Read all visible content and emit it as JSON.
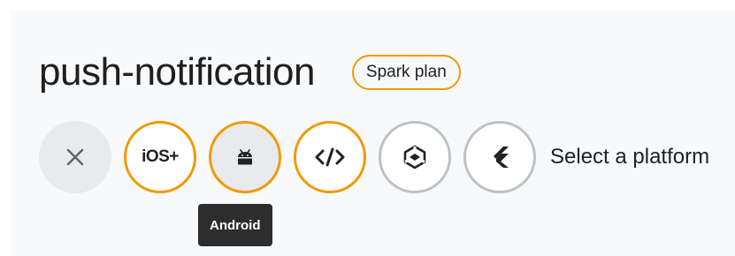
{
  "project": {
    "title": "push-notification",
    "plan_badge": "Spark plan"
  },
  "platforms": {
    "close_icon": "close-icon",
    "items": [
      {
        "id": "ios",
        "label": "iOS+",
        "icon": "ios-icon",
        "state": "selected"
      },
      {
        "id": "android",
        "icon": "android-icon",
        "state": "selected-hovered"
      },
      {
        "id": "web",
        "icon": "code-icon",
        "state": "selected"
      },
      {
        "id": "unity",
        "icon": "unity-icon",
        "state": "unselected"
      },
      {
        "id": "flutter",
        "icon": "flutter-icon",
        "state": "unselected"
      }
    ],
    "prompt": "Select a platform"
  },
  "tooltip": {
    "text": "Android"
  },
  "colors": {
    "accent": "#f29900",
    "unselected_border": "#bdc1c6",
    "close_bg": "#e8eaed",
    "tooltip_bg": "#2d2d2d",
    "panel_bg": "#f8f9fa"
  }
}
